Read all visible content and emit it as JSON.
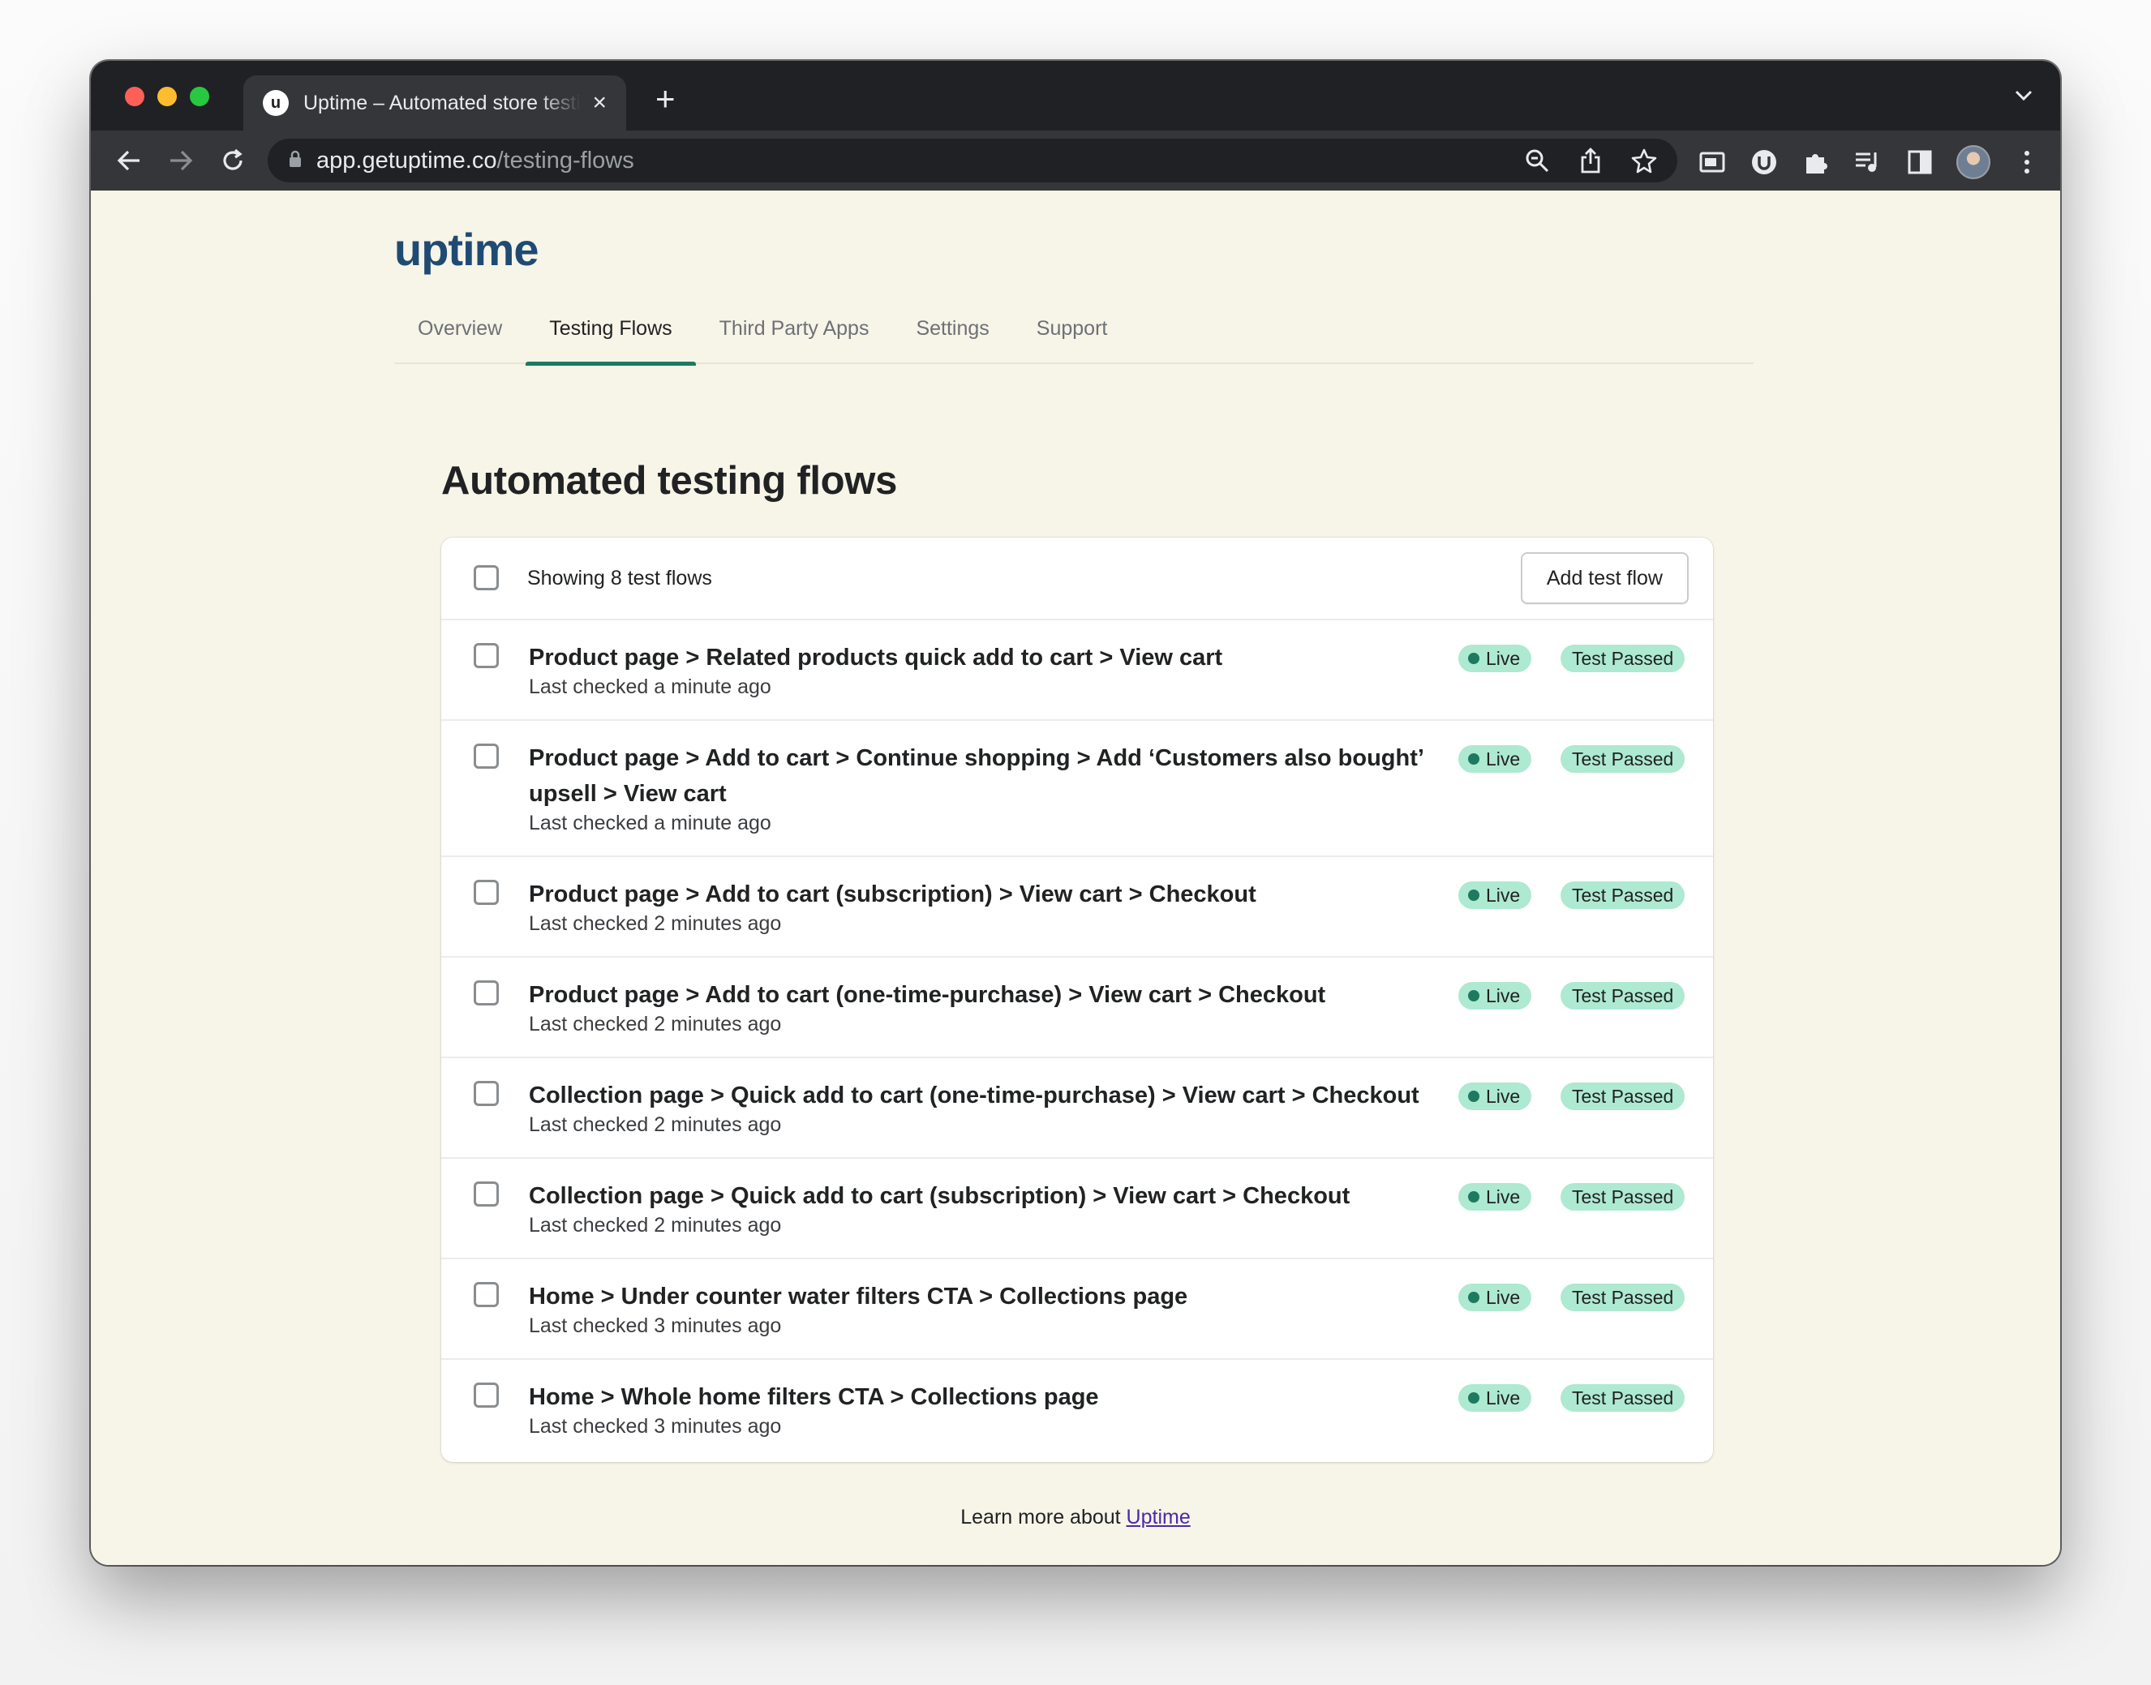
{
  "browser": {
    "tab_title": "Uptime – Automated store testing",
    "tab_favicon": "u",
    "url_host": "app.getuptime.co",
    "url_path": "/testing-flows"
  },
  "app": {
    "logo": "uptime",
    "nav": [
      "Overview",
      "Testing Flows",
      "Third Party Apps",
      "Settings",
      "Support"
    ],
    "active_nav": "Testing Flows"
  },
  "main": {
    "heading": "Automated testing flows",
    "showing_label": "Showing 8 test flows",
    "add_button_label": "Add test flow",
    "live_label": "Live",
    "status_label": "Test Passed",
    "flows": [
      {
        "title": "Product page > Related products quick add to cart > View cart",
        "last_checked": "Last checked a minute ago"
      },
      {
        "title": "Product page > Add to cart > Continue shopping > Add ‘Customers also bought’ upsell > View cart",
        "last_checked": "Last checked a minute ago"
      },
      {
        "title": "Product page > Add to cart (subscription) > View cart > Checkout",
        "last_checked": "Last checked 2 minutes ago"
      },
      {
        "title": "Product page > Add to cart (one-time-purchase) > View cart > Checkout",
        "last_checked": "Last checked 2 minutes ago"
      },
      {
        "title": "Collection page > Quick add to cart (one-time-purchase) > View cart > Checkout",
        "last_checked": "Last checked 2 minutes ago"
      },
      {
        "title": "Collection page > Quick add to cart (subscription) > View cart > Checkout",
        "last_checked": "Last checked 2 minutes ago"
      },
      {
        "title": "Home > Under counter water filters CTA > Collections page",
        "last_checked": "Last checked 3 minutes ago"
      },
      {
        "title": "Home > Whole home filters CTA > Collections page",
        "last_checked": "Last checked 3 minutes ago"
      }
    ]
  },
  "footer": {
    "text": "Learn more about ",
    "link_text": "Uptime"
  },
  "colors": {
    "page_bg": "#f7f4e8",
    "brand": "#1f4b73",
    "accent": "#1d7a5f",
    "badge_bg": "#aee9d1"
  }
}
